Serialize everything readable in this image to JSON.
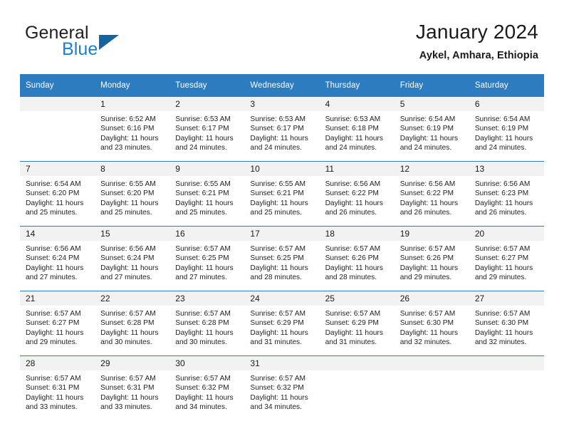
{
  "brand": {
    "name_top": "General",
    "name_bottom": "Blue",
    "accent_color": "#1b7fd4",
    "triangle_color": "#15639f",
    "triangle_icon": "triangle-logo-icon"
  },
  "header": {
    "title": "January 2024",
    "subtitle": "Aykel, Amhara, Ethiopia"
  },
  "theme": {
    "header_blue": "#2e7cc0",
    "daynum_band": "#f2f2f2",
    "text": "#1a1a1a"
  },
  "weekday_headers": [
    "Sunday",
    "Monday",
    "Tuesday",
    "Wednesday",
    "Thursday",
    "Friday",
    "Saturday"
  ],
  "labels": {
    "sunrise_prefix": "Sunrise:",
    "sunset_prefix": "Sunset:",
    "daylight_prefix": "Daylight:"
  },
  "weeks": [
    [
      {
        "day": "",
        "sunrise": "",
        "sunset": "",
        "daylight": ""
      },
      {
        "day": "1",
        "sunrise": "Sunrise: 6:52 AM",
        "sunset": "Sunset: 6:16 PM",
        "daylight": "Daylight: 11 hours and 23 minutes."
      },
      {
        "day": "2",
        "sunrise": "Sunrise: 6:53 AM",
        "sunset": "Sunset: 6:17 PM",
        "daylight": "Daylight: 11 hours and 24 minutes."
      },
      {
        "day": "3",
        "sunrise": "Sunrise: 6:53 AM",
        "sunset": "Sunset: 6:17 PM",
        "daylight": "Daylight: 11 hours and 24 minutes."
      },
      {
        "day": "4",
        "sunrise": "Sunrise: 6:53 AM",
        "sunset": "Sunset: 6:18 PM",
        "daylight": "Daylight: 11 hours and 24 minutes."
      },
      {
        "day": "5",
        "sunrise": "Sunrise: 6:54 AM",
        "sunset": "Sunset: 6:19 PM",
        "daylight": "Daylight: 11 hours and 24 minutes."
      },
      {
        "day": "6",
        "sunrise": "Sunrise: 6:54 AM",
        "sunset": "Sunset: 6:19 PM",
        "daylight": "Daylight: 11 hours and 24 minutes."
      }
    ],
    [
      {
        "day": "7",
        "sunrise": "Sunrise: 6:54 AM",
        "sunset": "Sunset: 6:20 PM",
        "daylight": "Daylight: 11 hours and 25 minutes."
      },
      {
        "day": "8",
        "sunrise": "Sunrise: 6:55 AM",
        "sunset": "Sunset: 6:20 PM",
        "daylight": "Daylight: 11 hours and 25 minutes."
      },
      {
        "day": "9",
        "sunrise": "Sunrise: 6:55 AM",
        "sunset": "Sunset: 6:21 PM",
        "daylight": "Daylight: 11 hours and 25 minutes."
      },
      {
        "day": "10",
        "sunrise": "Sunrise: 6:55 AM",
        "sunset": "Sunset: 6:21 PM",
        "daylight": "Daylight: 11 hours and 25 minutes."
      },
      {
        "day": "11",
        "sunrise": "Sunrise: 6:56 AM",
        "sunset": "Sunset: 6:22 PM",
        "daylight": "Daylight: 11 hours and 26 minutes."
      },
      {
        "day": "12",
        "sunrise": "Sunrise: 6:56 AM",
        "sunset": "Sunset: 6:22 PM",
        "daylight": "Daylight: 11 hours and 26 minutes."
      },
      {
        "day": "13",
        "sunrise": "Sunrise: 6:56 AM",
        "sunset": "Sunset: 6:23 PM",
        "daylight": "Daylight: 11 hours and 26 minutes."
      }
    ],
    [
      {
        "day": "14",
        "sunrise": "Sunrise: 6:56 AM",
        "sunset": "Sunset: 6:24 PM",
        "daylight": "Daylight: 11 hours and 27 minutes."
      },
      {
        "day": "15",
        "sunrise": "Sunrise: 6:56 AM",
        "sunset": "Sunset: 6:24 PM",
        "daylight": "Daylight: 11 hours and 27 minutes."
      },
      {
        "day": "16",
        "sunrise": "Sunrise: 6:57 AM",
        "sunset": "Sunset: 6:25 PM",
        "daylight": "Daylight: 11 hours and 27 minutes."
      },
      {
        "day": "17",
        "sunrise": "Sunrise: 6:57 AM",
        "sunset": "Sunset: 6:25 PM",
        "daylight": "Daylight: 11 hours and 28 minutes."
      },
      {
        "day": "18",
        "sunrise": "Sunrise: 6:57 AM",
        "sunset": "Sunset: 6:26 PM",
        "daylight": "Daylight: 11 hours and 28 minutes."
      },
      {
        "day": "19",
        "sunrise": "Sunrise: 6:57 AM",
        "sunset": "Sunset: 6:26 PM",
        "daylight": "Daylight: 11 hours and 29 minutes."
      },
      {
        "day": "20",
        "sunrise": "Sunrise: 6:57 AM",
        "sunset": "Sunset: 6:27 PM",
        "daylight": "Daylight: 11 hours and 29 minutes."
      }
    ],
    [
      {
        "day": "21",
        "sunrise": "Sunrise: 6:57 AM",
        "sunset": "Sunset: 6:27 PM",
        "daylight": "Daylight: 11 hours and 29 minutes."
      },
      {
        "day": "22",
        "sunrise": "Sunrise: 6:57 AM",
        "sunset": "Sunset: 6:28 PM",
        "daylight": "Daylight: 11 hours and 30 minutes."
      },
      {
        "day": "23",
        "sunrise": "Sunrise: 6:57 AM",
        "sunset": "Sunset: 6:28 PM",
        "daylight": "Daylight: 11 hours and 30 minutes."
      },
      {
        "day": "24",
        "sunrise": "Sunrise: 6:57 AM",
        "sunset": "Sunset: 6:29 PM",
        "daylight": "Daylight: 11 hours and 31 minutes."
      },
      {
        "day": "25",
        "sunrise": "Sunrise: 6:57 AM",
        "sunset": "Sunset: 6:29 PM",
        "daylight": "Daylight: 11 hours and 31 minutes."
      },
      {
        "day": "26",
        "sunrise": "Sunrise: 6:57 AM",
        "sunset": "Sunset: 6:30 PM",
        "daylight": "Daylight: 11 hours and 32 minutes."
      },
      {
        "day": "27",
        "sunrise": "Sunrise: 6:57 AM",
        "sunset": "Sunset: 6:30 PM",
        "daylight": "Daylight: 11 hours and 32 minutes."
      }
    ],
    [
      {
        "day": "28",
        "sunrise": "Sunrise: 6:57 AM",
        "sunset": "Sunset: 6:31 PM",
        "daylight": "Daylight: 11 hours and 33 minutes."
      },
      {
        "day": "29",
        "sunrise": "Sunrise: 6:57 AM",
        "sunset": "Sunset: 6:31 PM",
        "daylight": "Daylight: 11 hours and 33 minutes."
      },
      {
        "day": "30",
        "sunrise": "Sunrise: 6:57 AM",
        "sunset": "Sunset: 6:32 PM",
        "daylight": "Daylight: 11 hours and 34 minutes."
      },
      {
        "day": "31",
        "sunrise": "Sunrise: 6:57 AM",
        "sunset": "Sunset: 6:32 PM",
        "daylight": "Daylight: 11 hours and 34 minutes."
      },
      {
        "day": "",
        "sunrise": "",
        "sunset": "",
        "daylight": ""
      },
      {
        "day": "",
        "sunrise": "",
        "sunset": "",
        "daylight": ""
      },
      {
        "day": "",
        "sunrise": "",
        "sunset": "",
        "daylight": ""
      }
    ]
  ]
}
